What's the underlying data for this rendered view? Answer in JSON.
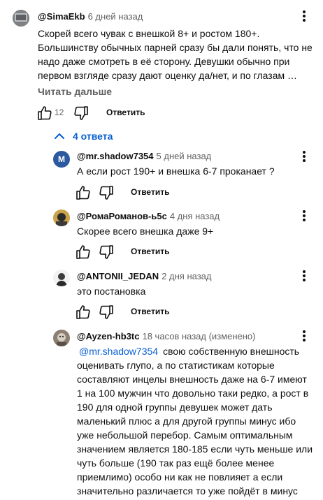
{
  "main_comment": {
    "author": "@SimaEkb",
    "time": "6 дней назад",
    "lines": [
      "Скорей всего чувак с внешкой 8+ и ростом 180+.",
      "Большинству обычных парней сразу бы дали понять, что не",
      "надо даже смотреть в её сторону. Девушки обычно при",
      "первом взгляде сразу дают оценку да/нет, и по глазам …"
    ],
    "read_more": "Читать дальше",
    "likes": "12",
    "reply_label": "Ответить"
  },
  "replies_toggle": {
    "label": "4 ответа"
  },
  "replies": [
    {
      "author": "@mr.shadow7354",
      "time": "5 дней назад",
      "avatar_letter": "M",
      "avatar_color": "#2c5aa0",
      "lines": [
        "А если рост 190+ и внешка 6-7 проканает ?"
      ],
      "reply_label": "Ответить"
    },
    {
      "author": "@РомаРоманов-ь5с",
      "time": "4 дня назад",
      "lines": [
        "Скорее всего внешка даже 9+"
      ],
      "reply_label": "Ответить"
    },
    {
      "author": "@ANTONII_JEDAN",
      "time": "2 дня назад",
      "lines": [
        "это постановка"
      ],
      "reply_label": "Ответить"
    },
    {
      "author": "@Ayzen-hb3tc",
      "time": "18 часов назад (изменено)",
      "mention": "@mr.shadow7354",
      "first_line_rest": "свою собственную внешность",
      "lines": [
        "оценивать глупо, а по статистикам которые",
        "составляют инцелы внешность даже на 6-7 имеют",
        "1 на 100 мужчин что довольно таки редко, а рост в",
        "190 для одной группы девушек может дать",
        "маленький плюс а для другой группы минус ибо",
        "уже небольшой перебор. Самым оптимальным",
        "значением является 180-185 если чуть меньше или",
        "чуть больше (190 так раз ещё более менее",
        "приемлимо) особо ни как не повлияет а если",
        "значительно различается то уже пойдёт в минус"
      ]
    }
  ],
  "colors": {
    "link": "#065fd4",
    "secondary": "#606060",
    "text": "#0f0f0f"
  }
}
